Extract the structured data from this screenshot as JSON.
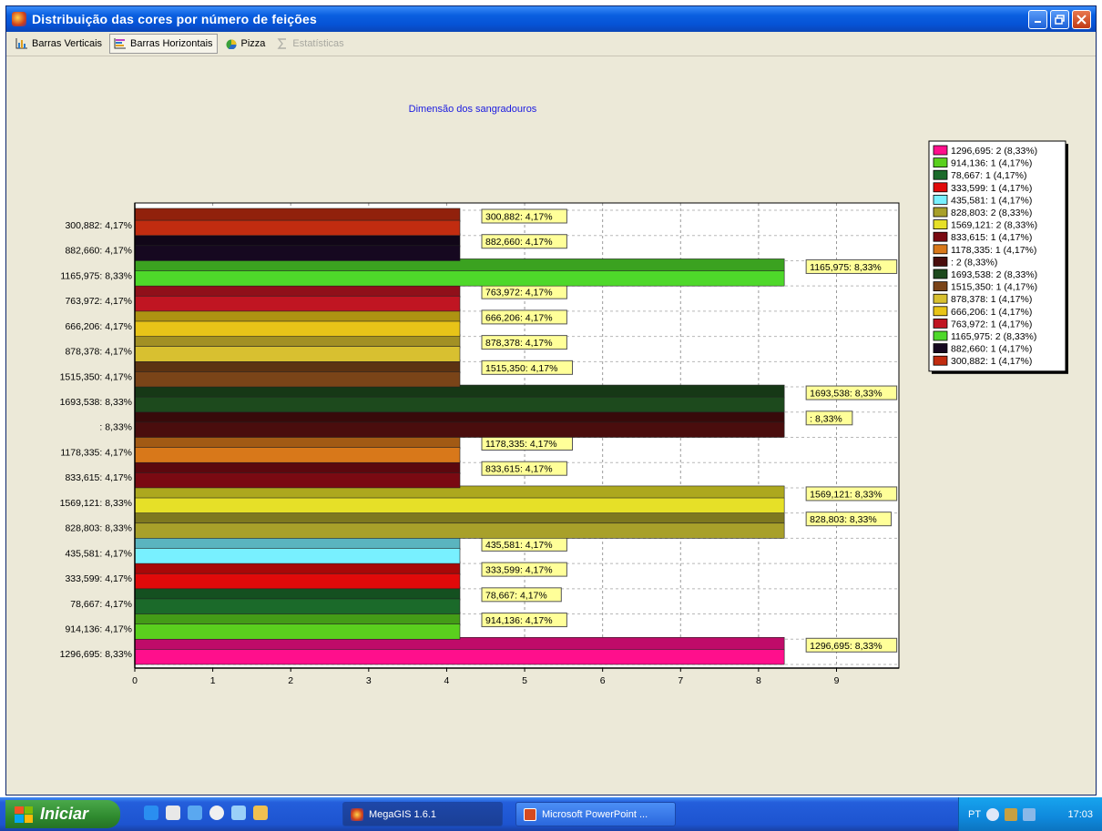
{
  "window": {
    "title": "Distribuição das cores por número de feições"
  },
  "toolbar": {
    "tabs": [
      {
        "label": "Barras Verticais",
        "icon": "bar-chart-vertical-icon",
        "active": false,
        "enabled": true
      },
      {
        "label": "Barras Horizontais",
        "icon": "bar-chart-horizontal-icon",
        "active": true,
        "enabled": true
      },
      {
        "label": "Pizza",
        "icon": "pie-chart-icon",
        "active": false,
        "enabled": true
      },
      {
        "label": "Estatísticas",
        "icon": "sigma-icon",
        "active": false,
        "enabled": false
      }
    ]
  },
  "chart_data": {
    "type": "bar",
    "orientation": "horizontal",
    "title": "Dimensão dos sangradouros",
    "xlim": [
      0,
      9.8
    ],
    "xticks": [
      0,
      1,
      2,
      3,
      4,
      5,
      6,
      7,
      8,
      9
    ],
    "grid": true,
    "legend_position": "right",
    "categories": [
      "1296,695: 8,33%",
      "914,136: 4,17%",
      "78,667: 4,17%",
      "333,599: 4,17%",
      "435,581: 4,17%",
      "828,803: 8,33%",
      "1569,121: 8,33%",
      "833,615: 4,17%",
      "1178,335: 4,17%",
      ": 8,33%",
      "1693,538: 8,33%",
      "1515,350: 4,17%",
      "878,378: 4,17%",
      "666,206: 4,17%",
      "763,972: 4,17%",
      "1165,975: 8,33%",
      "882,660: 4,17%",
      "300,882: 4,17%"
    ],
    "values": [
      8.33,
      4.17,
      4.17,
      4.17,
      4.17,
      8.33,
      8.33,
      4.17,
      4.17,
      8.33,
      8.33,
      4.17,
      4.17,
      4.17,
      4.17,
      8.33,
      4.17,
      4.17
    ],
    "colors": [
      "#ff0f8c",
      "#5ad01e",
      "#1b6a2a",
      "#e10a0a",
      "#78f0ff",
      "#a8a02a",
      "#e6e028",
      "#7a0a12",
      "#d8781a",
      "#4a0d0d",
      "#1d4a1d",
      "#7a4418",
      "#d8c030",
      "#e8c418",
      "#c01522",
      "#4ed82a",
      "#160820",
      "#c12c10"
    ],
    "legend": [
      "1296,695: 2 (8,33%)",
      "914,136: 1 (4,17%)",
      "78,667: 1 (4,17%)",
      "333,599: 1 (4,17%)",
      "435,581: 1 (4,17%)",
      "828,803: 2 (8,33%)",
      "1569,121: 2 (8,33%)",
      "833,615: 1 (4,17%)",
      "1178,335: 1 (4,17%)",
      ": 2 (8,33%)",
      "1693,538: 2 (8,33%)",
      "1515,350: 1 (4,17%)",
      "878,378: 1 (4,17%)",
      "666,206: 1 (4,17%)",
      "763,972: 1 (4,17%)",
      "1165,975: 2 (8,33%)",
      "882,660: 1 (4,17%)",
      "300,882: 1 (4,17%)"
    ]
  },
  "taskbar": {
    "start_label": "Iniciar",
    "tasks": [
      {
        "label": "MegaGIS 1.6.1",
        "active": true
      },
      {
        "label": "Microsoft PowerPoint ...",
        "active": false
      }
    ],
    "tray": {
      "language": "PT",
      "clock": "17:03"
    }
  }
}
